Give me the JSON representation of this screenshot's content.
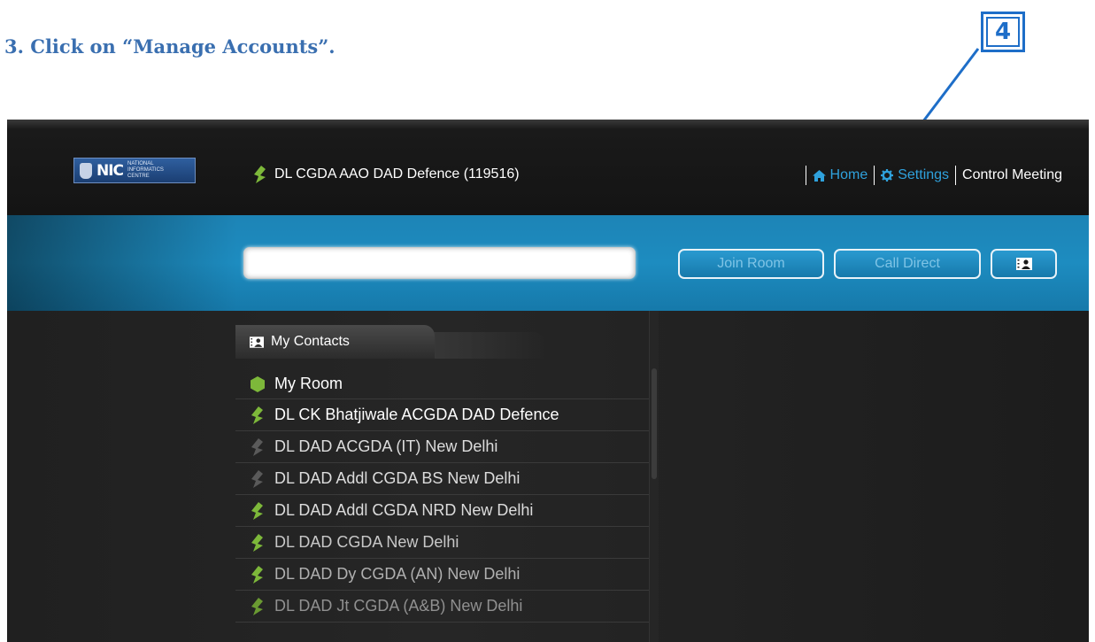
{
  "instruction": "3. Click on “Manage Accounts”.",
  "step_badge": "4",
  "logo": {
    "wordmark": "NIC",
    "subtitle": "NATIONAL INFORMATICS CENTRE"
  },
  "user": {
    "name": "DL CGDA AAO DAD Defence (119516)",
    "status_color": "#7db83a"
  },
  "nav": {
    "home": "Home",
    "settings": "Settings",
    "control": "Control Meeting",
    "link_color": "#2fa1dc"
  },
  "search": {
    "value": "",
    "placeholder": ""
  },
  "buttons": {
    "join_room": "Join Room",
    "call_direct": "Call Direct",
    "contacts_icon": "contact-card-icon"
  },
  "contacts": {
    "tab_label": "My Contacts",
    "items": [
      {
        "label": "My Room",
        "status": "room",
        "color": "#ffffff"
      },
      {
        "label": "DL CK Bhatjiwale ACGDA DAD Defence",
        "status": "online",
        "color": "#ffffff"
      },
      {
        "label": "DL DAD ACGDA (IT) New Delhi",
        "status": "offline",
        "color": "#dcdcdc"
      },
      {
        "label": "DL DAD Addl CGDA BS New Delhi",
        "status": "offline",
        "color": "#dcdcdc"
      },
      {
        "label": "DL DAD Addl CGDA NRD New Delhi",
        "status": "online",
        "color": "#dcdcdc"
      },
      {
        "label": "DL DAD CGDA New Delhi",
        "status": "online",
        "color": "#c8c8c8"
      },
      {
        "label": "DL DAD Dy CGDA (AN) New Delhi",
        "status": "online",
        "color": "#b0b0b0"
      },
      {
        "label": "DL DAD Jt CGDA (A&B) New Delhi",
        "status": "online",
        "color": "#909090"
      }
    ]
  },
  "colors": {
    "accent_blue": "#1d8cc0",
    "online_green": "#7db83a",
    "offline_gray": "#5a5a5a",
    "annotation_blue": "#1e6ec8"
  }
}
